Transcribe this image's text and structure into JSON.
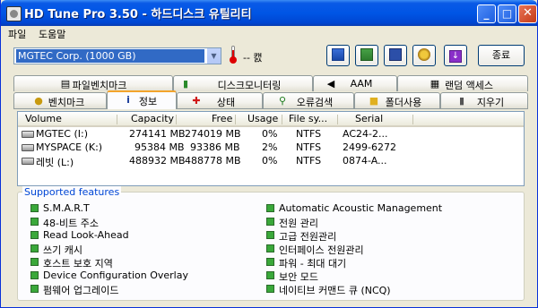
{
  "window": {
    "title": "HD Tune Pro 3.50 - 하드디스크 유틸리티",
    "minimize": "_",
    "maximize": "□",
    "close": "✕"
  },
  "menu": {
    "items": [
      "파일",
      "도움말"
    ]
  },
  "toolbar": {
    "drive_selected": "MGTEC  Corp. (1000 GB)",
    "temperature": "-- 캜",
    "exit_label": "종료",
    "icons": [
      "copy-icon",
      "copy-screenshot-icon",
      "save-icon",
      "options-icon",
      "download-icon"
    ]
  },
  "tabs": {
    "row1": [
      {
        "label": "파일벤치마크",
        "icon": "file-benchmark-icon"
      },
      {
        "label": "디스크모니터링",
        "icon": "disk-monitor-icon"
      },
      {
        "label": "AAM",
        "icon": "speaker-icon"
      },
      {
        "label": "랜덤 액세스",
        "icon": "random-access-icon"
      }
    ],
    "row2": [
      {
        "label": "벤치마크",
        "icon": "benchmark-icon"
      },
      {
        "label": "정보",
        "icon": "info-icon"
      },
      {
        "label": "상태",
        "icon": "health-icon"
      },
      {
        "label": "오류검색",
        "icon": "error-scan-icon"
      },
      {
        "label": "폴더사용",
        "icon": "folder-usage-icon"
      },
      {
        "label": "지우기",
        "icon": "erase-icon"
      }
    ],
    "active": "정보"
  },
  "volumes": {
    "columns": [
      "Volume",
      "Capacity",
      "Free",
      "Usage",
      "File sy...",
      "Serial"
    ],
    "rows": [
      {
        "volume": "MGTEC (I:)",
        "capacity": "274141 MB",
        "free": "274019 MB",
        "usage": "0%",
        "fs": "NTFS",
        "serial": "AC24-2..."
      },
      {
        "volume": "MYSPACE (K:)",
        "capacity": "95384 MB",
        "free": "93386 MB",
        "usage": "2%",
        "fs": "NTFS",
        "serial": "2499-6272"
      },
      {
        "volume": "레빗 (L:)",
        "capacity": "488932 MB",
        "free": "488778 MB",
        "usage": "0%",
        "fs": "NTFS",
        "serial": "0874-A..."
      }
    ]
  },
  "features": {
    "title": "Supported features",
    "left": [
      "S.M.A.R.T",
      "48-비트 주소",
      "Read Look-Ahead",
      "쓰기 캐시",
      "호스트 보호 지역",
      "Device Configuration Overlay",
      "펌웨어 업그레이드"
    ],
    "right": [
      "Automatic Acoustic Management",
      "전원 관리",
      "고급 전원관리",
      "인터페이스 전원관리",
      "파워 - 최대 대기",
      "보안 모드",
      "네이티브 커맨드 큐 (NCQ)"
    ]
  }
}
